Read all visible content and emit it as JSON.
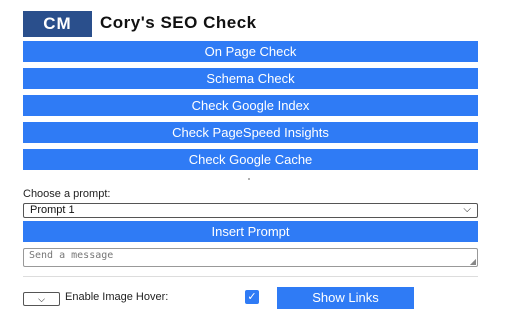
{
  "header": {
    "logo_text": "CM",
    "title": "Cory's SEO Check"
  },
  "buttons": [
    "On Page Check",
    "Schema Check",
    "Check Google Index",
    "Check PageSpeed Insights",
    "Check Google Cache"
  ],
  "prompt": {
    "label": "Choose a prompt:",
    "selected": "Prompt 1",
    "insert_label": "Insert Prompt",
    "message_placeholder": "Send a message"
  },
  "footer": {
    "hover_label": "Enable Image Hover:",
    "hover_checked": true,
    "show_links_label": "Show Links"
  },
  "colors": {
    "accent": "#2f7bf5",
    "logo_bg": "#2a4f8c"
  }
}
